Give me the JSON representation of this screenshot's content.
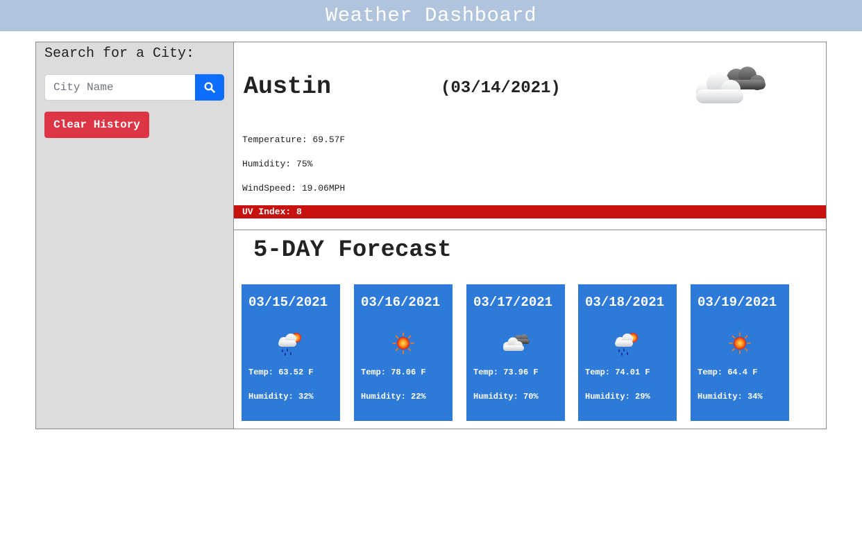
{
  "header": {
    "title": "Weather Dashboard"
  },
  "sidebar": {
    "title": "Search for a City:",
    "search_placeholder": "City Name",
    "search_icon": "search-icon",
    "clear_label": "Clear History"
  },
  "current": {
    "city": "Austin",
    "date": "(03/14/2021)",
    "icon": "broken-clouds-icon",
    "temperature": "Temperature: 69.57F",
    "humidity": "Humidity: 75%",
    "wind": "WindSpeed: 19.06MPH",
    "uv": "UV Index: 8",
    "uv_color": "#c8120f"
  },
  "forecast": {
    "title": "5-DAY Forecast",
    "card_color": "#2e7ad8",
    "days": [
      {
        "date": "03/15/2021",
        "icon": "rain-sun-icon",
        "temp": "Temp: 63.52 F",
        "humidity": "Humidity: 32%"
      },
      {
        "date": "03/16/2021",
        "icon": "sun-icon",
        "temp": "Temp: 78.06 F",
        "humidity": "Humidity: 22%"
      },
      {
        "date": "03/17/2021",
        "icon": "clouds-icon",
        "temp": "Temp: 73.96 F",
        "humidity": "Humidity: 70%"
      },
      {
        "date": "03/18/2021",
        "icon": "rain-sun-icon",
        "temp": "Temp: 74.01 F",
        "humidity": "Humidity: 29%"
      },
      {
        "date": "03/19/2021",
        "icon": "sun-icon",
        "temp": "Temp: 64.4 F",
        "humidity": "Humidity: 34%"
      }
    ]
  }
}
